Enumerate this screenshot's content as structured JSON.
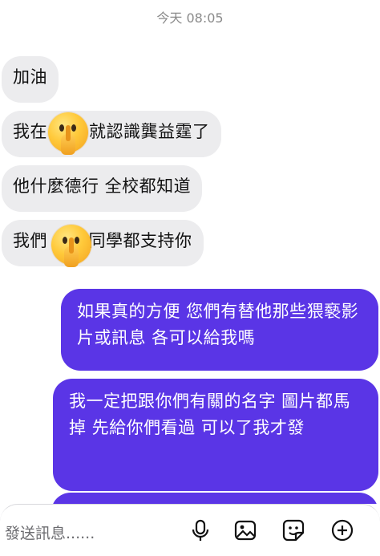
{
  "timestamp": "今天 08:05",
  "colors": {
    "outgoing_bubble": "#5a35e6",
    "incoming_bubble": "#ececee"
  },
  "messages": {
    "incoming": [
      {
        "text": "加油"
      },
      {
        "before": "我在",
        "after": "就認識龔益霆了",
        "emoji": "shushing-face-emoji"
      },
      {
        "text": "他什麼德行 全校都知道"
      },
      {
        "before": "我們",
        "after": "的同學都支持你",
        "emoji": "shushing-face-emoji"
      }
    ],
    "outgoing": [
      {
        "text": "如果真的方便 您們有替他那些猥褻影片或訊息 各可以給我嗎"
      },
      {
        "text": "我一定把跟你們有關的名字 圖片都馬掉 先給你們看過 可以了我才發"
      }
    ]
  },
  "composer": {
    "placeholder": "發送訊息......",
    "icons": [
      "microphone-icon",
      "image-icon",
      "sticker-icon",
      "add-icon"
    ]
  }
}
